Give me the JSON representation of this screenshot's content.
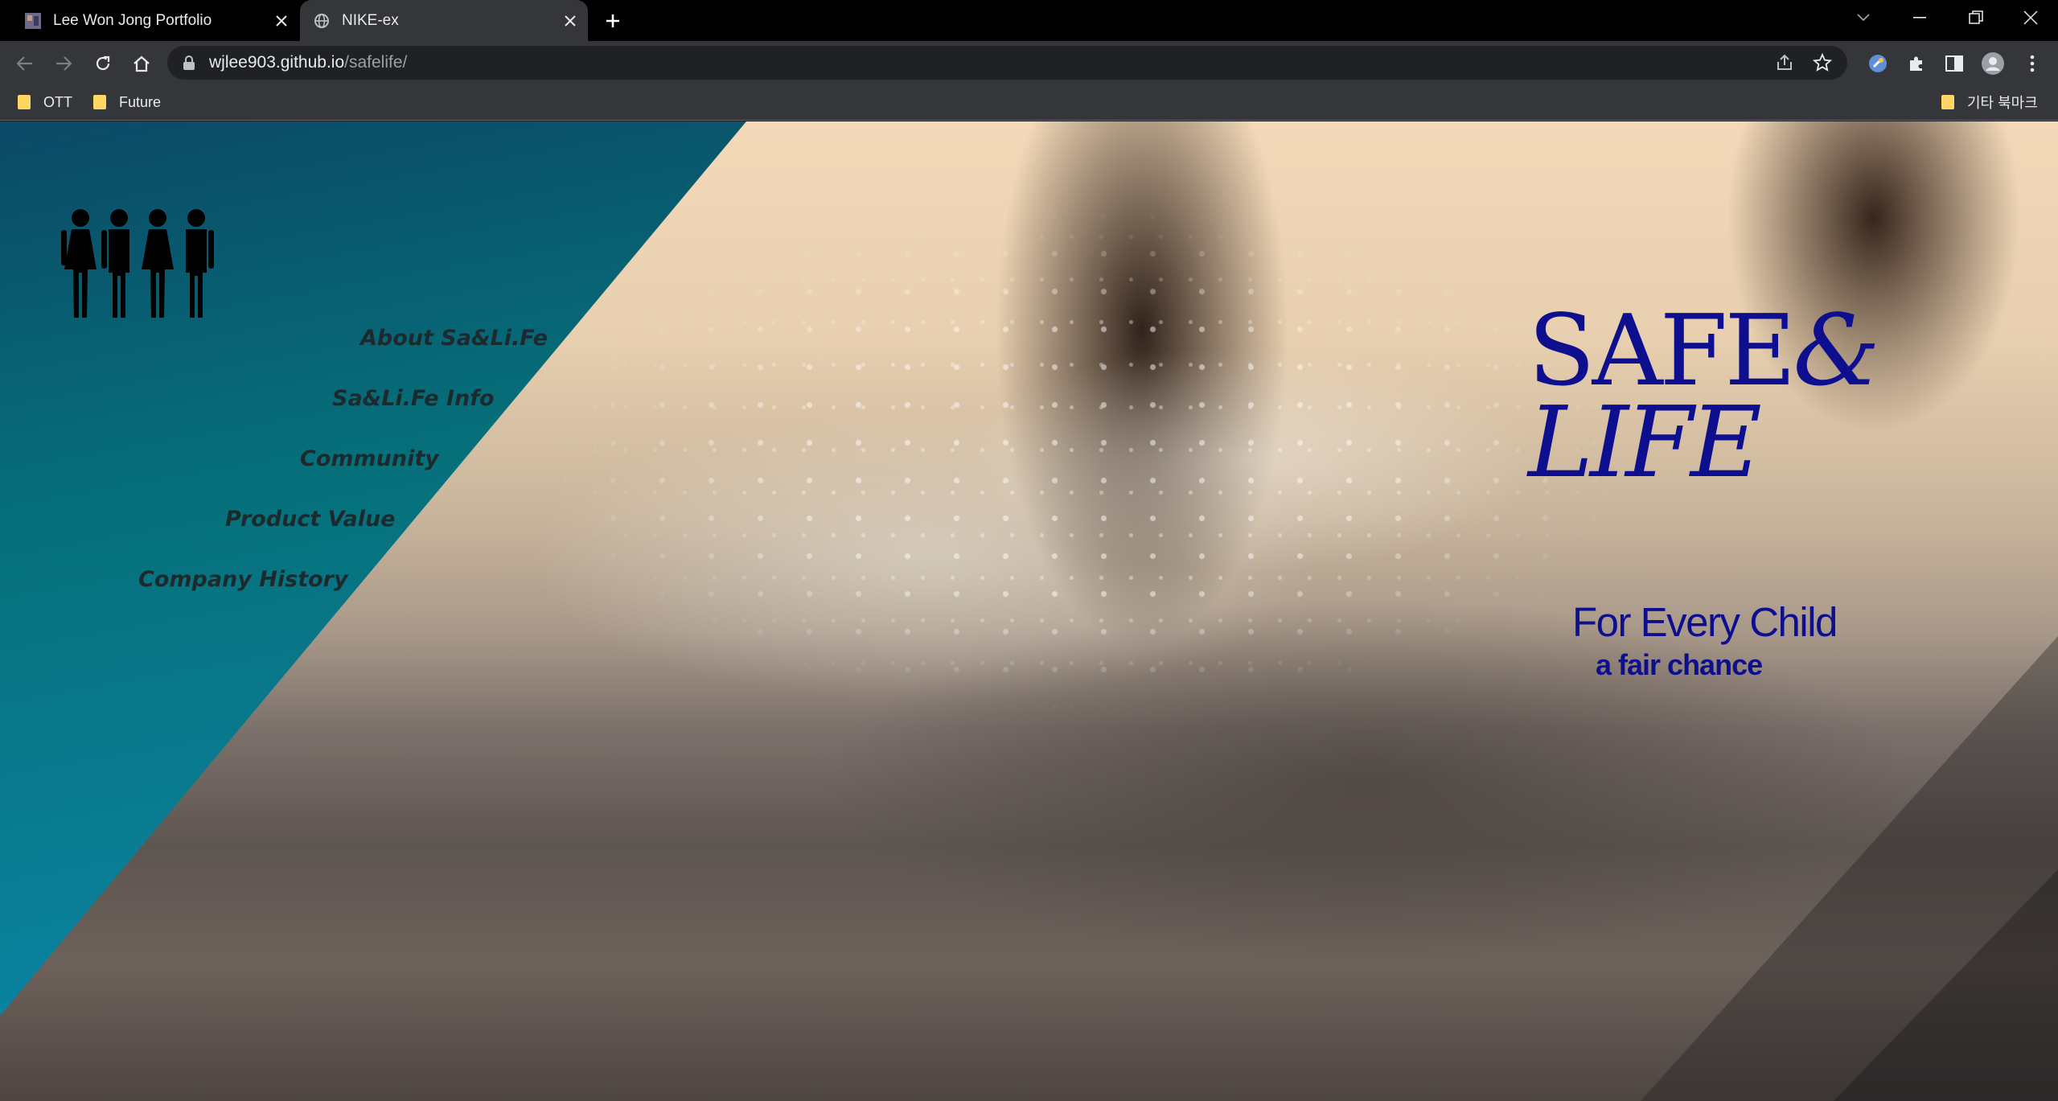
{
  "browser": {
    "tabs": [
      {
        "title": "Lee Won Jong Portfolio",
        "favicon": "portfolio-favicon",
        "active": false
      },
      {
        "title": "NIKE-ex",
        "favicon": "globe-icon",
        "active": true
      }
    ],
    "url": {
      "host": "wjlee903.github.io",
      "path": "/safelife/"
    },
    "bookmarks": [
      {
        "label": "OTT",
        "icon": "folder-icon"
      },
      {
        "label": "Future",
        "icon": "folder-icon"
      }
    ],
    "other_bookmarks": {
      "label": "기타 북마크",
      "icon": "folder-icon"
    }
  },
  "page": {
    "logo": "four-people-icon",
    "nav": [
      {
        "label": "About Sa&Li.Fe"
      },
      {
        "label": "Sa&Li.Fe Info"
      },
      {
        "label": "Community"
      },
      {
        "label": "Product Value"
      },
      {
        "label": "Company History"
      }
    ],
    "brand": {
      "line1": "SAFE",
      "amp": "&",
      "line2": "LIFE"
    },
    "tagline": "For Every Child",
    "subtagline": "a fair chance"
  },
  "colors": {
    "brand_text": "#0d0f8f",
    "sidebar_top": "#0b4966",
    "sidebar_bottom": "#0597c8",
    "nav_text": "#1c2a2e"
  }
}
